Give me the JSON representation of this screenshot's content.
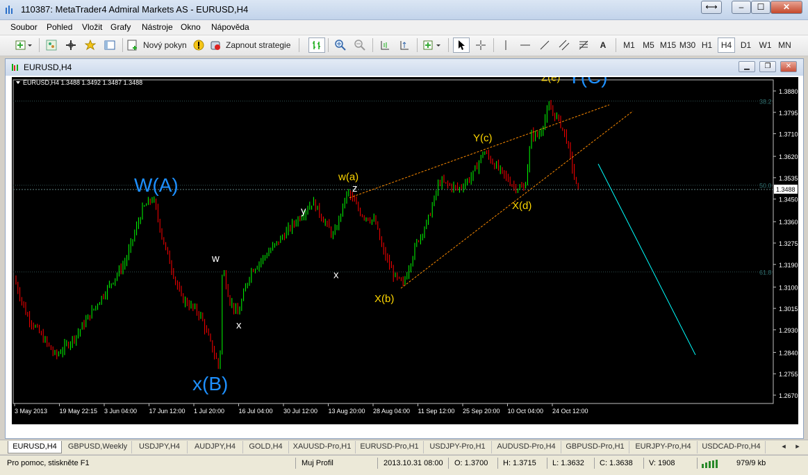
{
  "window": {
    "title": "110387: MetaTrader4 Admiral Markets AS - EURUSD,H4"
  },
  "menu": [
    "Soubor",
    "Pohled",
    "Vložit",
    "Grafy",
    "Nástroje",
    "Okno",
    "Nápověda"
  ],
  "toolbar": {
    "new_order_label": "Nový pokyn",
    "autotrading_label": "Zapnout strategie",
    "timeframes": [
      "M1",
      "M5",
      "M15",
      "M30",
      "H1",
      "H4",
      "D1",
      "W1",
      "MN"
    ],
    "active_timeframe": "H4",
    "text_tool_label": "A"
  },
  "chart_window": {
    "title": "EURUSD,H4"
  },
  "chart_data": {
    "type": "candlestick",
    "info_line": "EURUSD,H4  1.3488 1.3492 1.3487 1.3488",
    "current_price": "1.3488",
    "y_ticks": [
      "1.3880",
      "1.3795",
      "1.3710",
      "1.3620",
      "1.3535",
      "1.3450",
      "1.3360",
      "1.3275",
      "1.3190",
      "1.3100",
      "1.3015",
      "1.2930",
      "1.2840",
      "1.2755",
      "1.2670"
    ],
    "y_range": [
      1.267,
      1.388
    ],
    "x_ticks": [
      "3 May 2013",
      "19 May 22:15",
      "3 Jun 04:00",
      "17 Jun 12:00",
      "1 Jul 20:00",
      "16 Jul 04:00",
      "30 Jul 12:00",
      "13 Aug 20:00",
      "28 Aug 04:00",
      "11 Sep 12:00",
      "25 Sep 20:00",
      "10 Oct 04:00",
      "24 Oct 12:00"
    ],
    "fib_levels": [
      {
        "label": "38.2",
        "price": 1.384
      },
      {
        "label": "50.0",
        "price": 1.3505
      },
      {
        "label": "61.8",
        "price": 1.316
      }
    ],
    "wave_labels": [
      {
        "text": "W(A)",
        "color": "#1e90ff",
        "price": 1.348
      },
      {
        "text": "x(B)",
        "color": "#1e90ff",
        "price": 1.269
      },
      {
        "text": "Y(C)",
        "color": "#1e90ff",
        "price": 1.391
      },
      {
        "text": "w(a)",
        "color": "#ffd700",
        "price": 1.3525
      },
      {
        "text": "X(b)",
        "color": "#ffd700",
        "price": 1.304
      },
      {
        "text": "Y(c)",
        "color": "#ffd700",
        "price": 1.368
      },
      {
        "text": "X(d)",
        "color": "#ffd700",
        "price": 1.341
      },
      {
        "text": "Z(e)",
        "color": "#ffd700",
        "price": 1.392
      },
      {
        "text": "w",
        "color": "#ffffff",
        "price": 1.32
      },
      {
        "text": "x",
        "color": "#ffffff",
        "price": 1.2935
      },
      {
        "text": "y",
        "color": "#ffffff",
        "price": 1.339
      },
      {
        "text": "x",
        "color": "#ffffff",
        "price": 1.3135
      },
      {
        "text": "z",
        "color": "#ffffff",
        "price": 1.348
      }
    ],
    "colors": {
      "bull": "#00ff00",
      "bear": "#ff0000",
      "background": "#000000",
      "grid": "#2f4f4f",
      "trendline": "#ff8c00",
      "projection": "#00ffff"
    }
  },
  "symbol_tabs": [
    "EURUSD,H4",
    "GBPUSD,Weekly",
    "USDJPY,H4",
    "AUDJPY,H4",
    "GOLD,H4",
    "XAUUSD-Pro,H1",
    "EURUSD-Pro,H1",
    "USDJPY-Pro,H1",
    "AUDUSD-Pro,H4",
    "GBPUSD-Pro,H1",
    "EURJPY-Pro,H4",
    "USDCAD-Pro,H4"
  ],
  "status": {
    "help": "Pro pomoc, stiskněte F1",
    "profile": "Muj Profil",
    "datetime": "2013.10.31 08:00",
    "open": "O: 1.3700",
    "high": "H: 1.3715",
    "low": "L: 1.3632",
    "close": "C: 1.3638",
    "volume": "V: 1908",
    "traffic": "979/9 kb"
  }
}
